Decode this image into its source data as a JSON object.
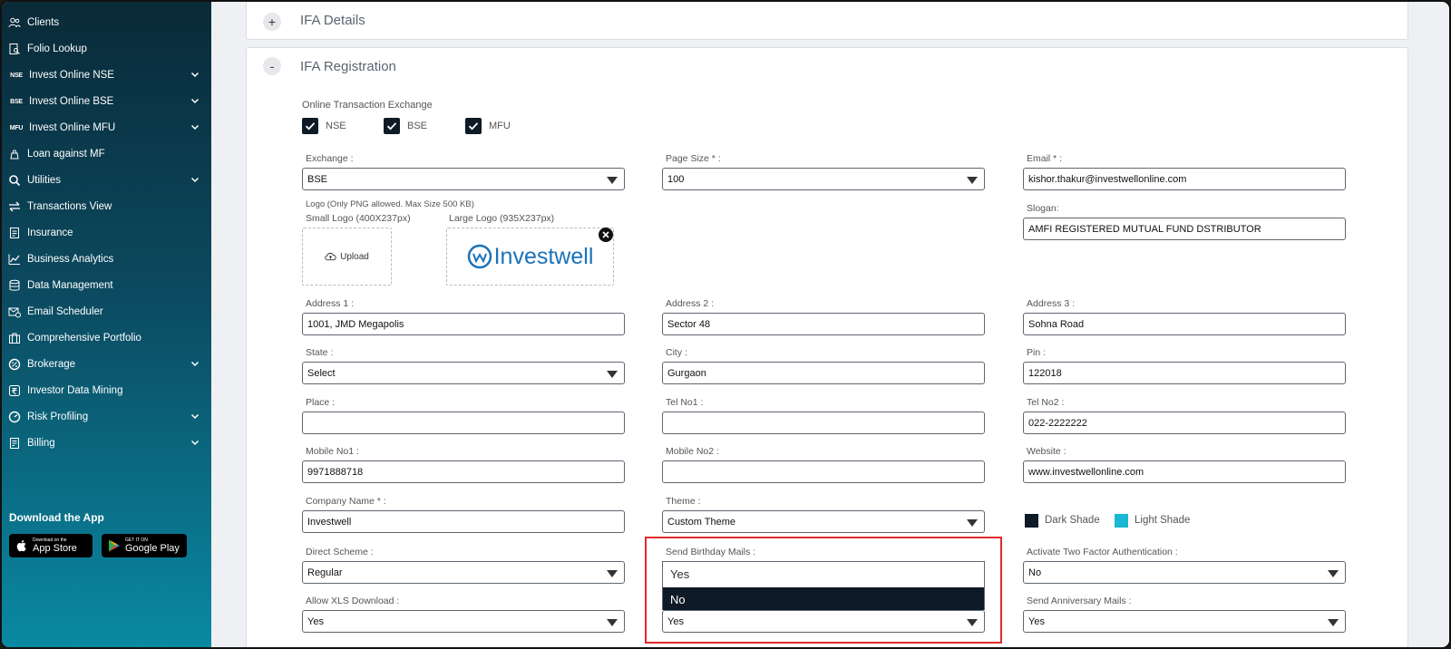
{
  "sidebar": {
    "items": [
      {
        "label": "Clients",
        "icon": "clients-icon",
        "has_chevron": false
      },
      {
        "label": "Folio Lookup",
        "icon": "folio-lookup-icon",
        "has_chevron": false
      },
      {
        "label": "Invest Online NSE",
        "icon": "NSE",
        "has_chevron": true
      },
      {
        "label": "Invest Online BSE",
        "icon": "BSE",
        "has_chevron": true
      },
      {
        "label": "Invest Online MFU",
        "icon": "MFU",
        "has_chevron": true
      },
      {
        "label": "Loan against MF",
        "icon": "loan-icon",
        "has_chevron": false
      },
      {
        "label": "Utilities",
        "icon": "utilities-icon",
        "has_chevron": true
      },
      {
        "label": "Transactions View",
        "icon": "transactions-icon",
        "has_chevron": false
      },
      {
        "label": "Insurance",
        "icon": "insurance-icon",
        "has_chevron": false
      },
      {
        "label": "Business Analytics",
        "icon": "analytics-icon",
        "has_chevron": false
      },
      {
        "label": "Data Management",
        "icon": "data-management-icon",
        "has_chevron": false
      },
      {
        "label": "Email Scheduler",
        "icon": "email-scheduler-icon",
        "has_chevron": false
      },
      {
        "label": "Comprehensive Portfolio",
        "icon": "portfolio-icon",
        "has_chevron": false
      },
      {
        "label": "Brokerage",
        "icon": "brokerage-icon",
        "has_chevron": true
      },
      {
        "label": "Investor Data Mining",
        "icon": "rupee-icon",
        "has_chevron": false
      },
      {
        "label": "Risk Profiling",
        "icon": "risk-profiling-icon",
        "has_chevron": true
      },
      {
        "label": "Billing",
        "icon": "billing-icon",
        "has_chevron": true
      }
    ],
    "download_title": "Download the App",
    "app_store_small": "Download on the",
    "app_store_big": "App Store",
    "google_play_small": "GET IT ON",
    "google_play_big": "Google Play"
  },
  "panels": {
    "ifa_details_title": "IFA Details",
    "ifa_details_toggle": "+",
    "ifa_registration_title": "IFA Registration",
    "ifa_registration_toggle": "-"
  },
  "form": {
    "exchange_group_label": "Online Transaction Exchange",
    "exchanges": [
      {
        "label": "NSE",
        "checked": true
      },
      {
        "label": "BSE",
        "checked": true
      },
      {
        "label": "MFU",
        "checked": true
      }
    ],
    "exchange_label": "Exchange :",
    "exchange_value": "BSE",
    "page_size_label": "Page Size * :",
    "page_size_value": "100",
    "email_label": "Email * :",
    "email_value": "kishor.thakur@investwellonline.com",
    "logo_label": "Logo (Only PNG allowed. Max Size 500 KB)",
    "small_logo_label": "Small Logo (400X237px)",
    "large_logo_label": "Large Logo (935X237px)",
    "upload_label": "Upload",
    "logo_brand_text": "Investwell",
    "slogan_label": "Slogan:",
    "slogan_value": "AMFI REGISTERED MUTUAL FUND DSTRIBUTOR",
    "address1_label": "Address 1 :",
    "address1_value": "1001, JMD Megapolis",
    "address2_label": "Address 2 :",
    "address2_value": "Sector 48",
    "address3_label": "Address 3 :",
    "address3_value": "Sohna Road",
    "state_label": "State :",
    "state_value": "Select",
    "city_label": "City :",
    "city_value": "Gurgaon",
    "pin_label": "Pin :",
    "pin_value": "122018",
    "place_label": "Place :",
    "place_value": "",
    "tel1_label": "Tel No1 :",
    "tel1_value": "",
    "tel2_label": "Tel No2 :",
    "tel2_value": "022-2222222",
    "mobile1_label": "Mobile No1 :",
    "mobile1_value": "9971888718",
    "mobile2_label": "Mobile No2 :",
    "mobile2_value": "",
    "website_label": "Website :",
    "website_value": "www.investwellonline.com",
    "company_label": "Company Name * :",
    "company_value": "Investwell",
    "theme_label": "Theme :",
    "theme_value": "Custom Theme",
    "dark_shade_label": "Dark Shade",
    "light_shade_label": "Light Shade",
    "direct_scheme_label": "Direct Scheme :",
    "direct_scheme_value": "Regular",
    "birthday_label": "Send Birthday Mails :",
    "birthday_options": [
      "Yes",
      "No"
    ],
    "birthday_value": "Yes",
    "two_factor_label": "Activate Two Factor Authentication :",
    "two_factor_value": "No",
    "xls_label": "Allow XLS Download :",
    "xls_value": "Yes",
    "anniversary_label": "Send Anniversary Mails :",
    "anniversary_value": "Yes"
  },
  "colors": {
    "dark_shade": "#0e1a25",
    "light_shade": "#1ab8d2",
    "highlight": "#e02a2a",
    "brand_blue": "#1a72b8"
  }
}
